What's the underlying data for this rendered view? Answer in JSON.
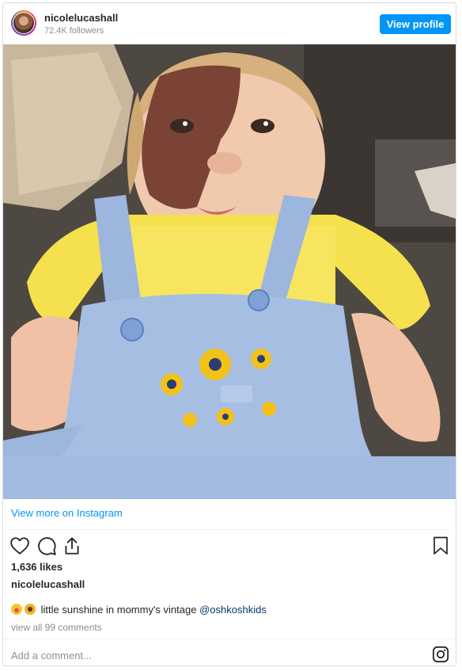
{
  "header": {
    "username": "nicolelucashall",
    "followers": "72.4K followers",
    "view_profile_label": "View profile"
  },
  "photo": {
    "subject": "baby-in-overalls-photo"
  },
  "footer": {
    "view_more_label": "View more on Instagram",
    "likes": "1,636 likes",
    "caption_user": "nicolelucashall",
    "caption_text": "little sunshine in mommy's vintage ",
    "caption_mention": "@oshkoshkids",
    "view_comments": "view all 99 comments",
    "comment_placeholder": "Add a comment..."
  },
  "colors": {
    "accent": "#0095f6",
    "mention": "#00376b",
    "muted": "#8e8e8e",
    "text": "#262626"
  },
  "icons": {
    "like": "heart-icon",
    "comment": "comment-icon",
    "share": "share-icon",
    "save": "bookmark-icon",
    "brand": "instagram-icon"
  }
}
